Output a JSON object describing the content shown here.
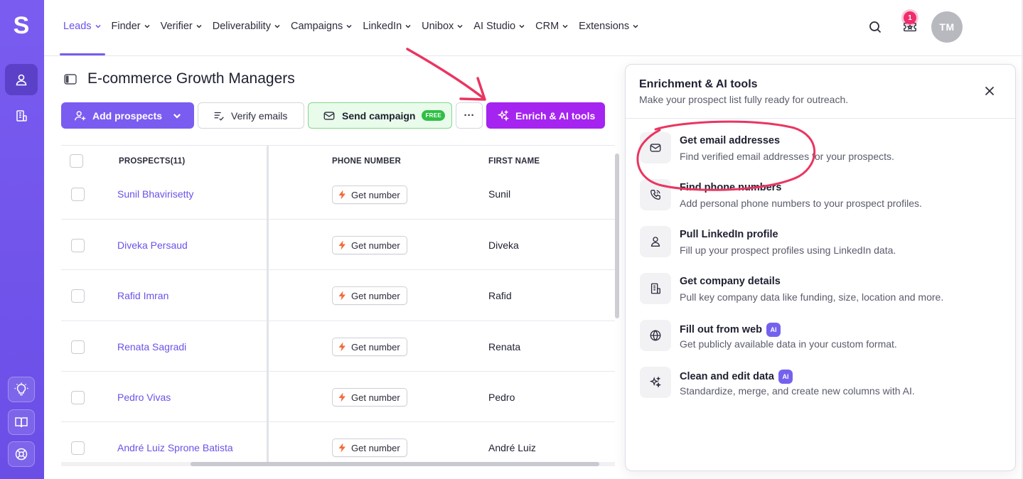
{
  "rail": {
    "logo": "S",
    "items": [
      {
        "icon": "person-icon",
        "active": true
      },
      {
        "icon": "building-list-icon",
        "active": false
      },
      {
        "icon": "lightbulb-icon",
        "active": false
      },
      {
        "icon": "book-icon",
        "active": false
      },
      {
        "icon": "lifebuoy-icon",
        "active": false
      }
    ]
  },
  "nav": {
    "items": [
      {
        "label": "Leads",
        "active": true
      },
      {
        "label": "Finder"
      },
      {
        "label": "Verifier"
      },
      {
        "label": "Deliverability"
      },
      {
        "label": "Campaigns"
      },
      {
        "label": "LinkedIn"
      },
      {
        "label": "Unibox"
      },
      {
        "label": "AI Studio"
      },
      {
        "label": "CRM"
      },
      {
        "label": "Extensions"
      }
    ],
    "notifications_count": "1",
    "avatar_initials": "TM"
  },
  "page": {
    "title": "E-commerce Growth Managers"
  },
  "toolbar": {
    "add_prospects": "Add prospects",
    "verify_emails": "Verify emails",
    "send_campaign": "Send campaign",
    "free_badge": "FREE",
    "more": "···",
    "enrich": "Enrich & AI tools"
  },
  "table": {
    "headers": {
      "prospects": "PROSPECTS(11)",
      "phone": "PHONE NUMBER",
      "first_name": "FIRST NAME"
    },
    "get_number_label": "Get number",
    "rows": [
      {
        "name": "Sunil Bhavirisetty",
        "first_name": "Sunil"
      },
      {
        "name": "Diveka Persaud",
        "first_name": "Diveka"
      },
      {
        "name": "Rafid Imran",
        "first_name": "Rafid"
      },
      {
        "name": "Renata Sagradi",
        "first_name": "Renata"
      },
      {
        "name": "Pedro Vivas",
        "first_name": "Pedro"
      },
      {
        "name": "André Luiz Sprone Batista",
        "first_name": "André Luiz"
      }
    ]
  },
  "panel": {
    "title": "Enrichment & AI tools",
    "subtitle": "Make your prospect list fully ready for outreach.",
    "tools": [
      {
        "name": "Get email addresses",
        "desc": "Find verified email addresses for your prospects.",
        "icon": "envelope-icon",
        "ai": false
      },
      {
        "name": "Find phone numbers",
        "desc": "Add personal phone numbers to your prospect profiles.",
        "icon": "phone-icon",
        "ai": false
      },
      {
        "name": "Pull LinkedIn profile",
        "desc": "Fill up your prospect profiles using LinkedIn data.",
        "icon": "person-icon",
        "ai": false
      },
      {
        "name": "Get company details",
        "desc": "Pull key company data like funding, size, location and more.",
        "icon": "building-icon",
        "ai": false
      },
      {
        "name": "Fill out from web",
        "desc": "Get publicly available data in your custom format.",
        "icon": "globe-icon",
        "ai": true
      },
      {
        "name": "Clean and edit data",
        "desc": "Standardize, merge, and create new columns with AI.",
        "icon": "sparkle-icon",
        "ai": true
      }
    ],
    "ai_badge": "AI"
  },
  "colors": {
    "brand": "#7a5cf0",
    "enrich": "#a524f0",
    "send_bg": "#e9fbeb",
    "free": "#2fbf45",
    "annotation": "#ea3560"
  }
}
